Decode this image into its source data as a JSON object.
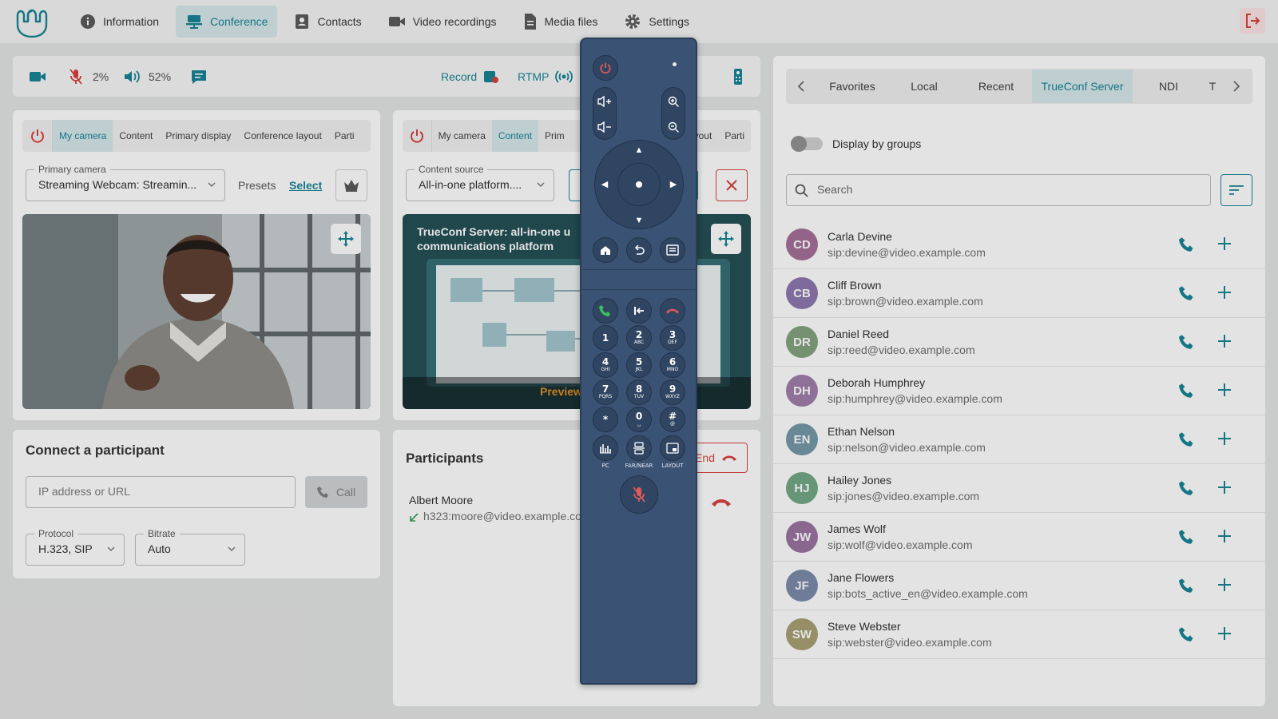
{
  "nav": {
    "items": [
      {
        "label": "Information",
        "icon": "info-icon"
      },
      {
        "label": "Conference",
        "icon": "conference-icon",
        "active": true
      },
      {
        "label": "Contacts",
        "icon": "contacts-icon"
      },
      {
        "label": "Video recordings",
        "icon": "video-camera-icon"
      },
      {
        "label": "Media files",
        "icon": "document-icon"
      },
      {
        "label": "Settings",
        "icon": "gear-icon"
      }
    ]
  },
  "control_bar": {
    "mic_level": "2%",
    "volume_level": "52%",
    "record_label": "Record",
    "rtmp_label": "RTMP"
  },
  "camera_card": {
    "tabs": [
      "My camera",
      "Content",
      "Primary display",
      "Conference layout",
      "Parti"
    ],
    "active_tab": "My camera",
    "primary_camera_label": "Primary camera",
    "primary_camera_value": "Streaming Webcam: Streamin...",
    "presets_label": "Presets",
    "select_label": "Select"
  },
  "content_card": {
    "tabs": [
      "My camera",
      "Content",
      "Prim",
      "yout",
      "Parti"
    ],
    "active_tab": "Content",
    "source_label": "Content source",
    "source_value": "All-in-one platform....",
    "preview_title_1": "TrueConf Server: all-in-one u",
    "preview_title_2": "communications platform",
    "preview_label": "Preview"
  },
  "connect": {
    "title": "Connect a participant",
    "address_placeholder": "IP address or URL",
    "call_label": "Call",
    "protocol_label": "Protocol",
    "protocol_value": "H.323, SIP",
    "bitrate_label": "Bitrate",
    "bitrate_value": "Auto"
  },
  "participants": {
    "title": "Participants",
    "end_label": "End",
    "list": [
      {
        "name": "Albert Moore",
        "address": "h323:moore@video.example.co"
      }
    ]
  },
  "remote": {
    "keys": [
      {
        "digit": "1",
        "letters": ""
      },
      {
        "digit": "2",
        "letters": "ABC"
      },
      {
        "digit": "3",
        "letters": "DEF"
      },
      {
        "digit": "4",
        "letters": "GHI"
      },
      {
        "digit": "5",
        "letters": "JKL"
      },
      {
        "digit": "6",
        "letters": "MNO"
      },
      {
        "digit": "7",
        "letters": "PQRS"
      },
      {
        "digit": "8",
        "letters": "TUV"
      },
      {
        "digit": "9",
        "letters": "WXYZ"
      },
      {
        "digit": "*",
        "letters": ""
      },
      {
        "digit": "0",
        "letters": "␣"
      },
      {
        "digit": "#",
        "letters": "@"
      }
    ],
    "func_labels": {
      "pc": "PC",
      "farnear": "FAR/NEAR",
      "layout": "LAYOUT"
    }
  },
  "address_book": {
    "tabs": [
      "Favorites",
      "Local",
      "Recent",
      "TrueConf Server",
      "NDI",
      "T"
    ],
    "active_tab": "TrueConf Server",
    "display_by_groups_label": "Display by groups",
    "search_placeholder": "Search",
    "contacts": [
      {
        "initials": "CD",
        "name": "Carla Devine",
        "sip": "sip:devine@video.example.com",
        "color": "#a26c95"
      },
      {
        "initials": "CB",
        "name": "Cliff Brown",
        "sip": "sip:brown@video.example.com",
        "color": "#8a74ad"
      },
      {
        "initials": "DR",
        "name": "Daniel Reed",
        "sip": "sip:reed@video.example.com",
        "color": "#7fa07c"
      },
      {
        "initials": "DH",
        "name": "Deborah Humphrey",
        "sip": "sip:humphrey@video.example.com",
        "color": "#9c7aa8"
      },
      {
        "initials": "EN",
        "name": "Ethan Nelson",
        "sip": "sip:nelson@video.example.com",
        "color": "#6f95a3"
      },
      {
        "initials": "HJ",
        "name": "Hailey Jones",
        "sip": "sip:jones@video.example.com",
        "color": "#6fa582"
      },
      {
        "initials": "JW",
        "name": "James Wolf",
        "sip": "sip:wolf@video.example.com",
        "color": "#976f9e"
      },
      {
        "initials": "JF",
        "name": "Jane Flowers",
        "sip": "sip:bots_active_en@video.example.com",
        "color": "#7787a8"
      },
      {
        "initials": "SW",
        "name": "Steve Webster",
        "sip": "sip:webster@video.example.com",
        "color": "#a59c6f"
      }
    ]
  },
  "colors": {
    "accent": "#117f92",
    "danger": "#d63a3a",
    "remote_body": "#3a5273"
  }
}
